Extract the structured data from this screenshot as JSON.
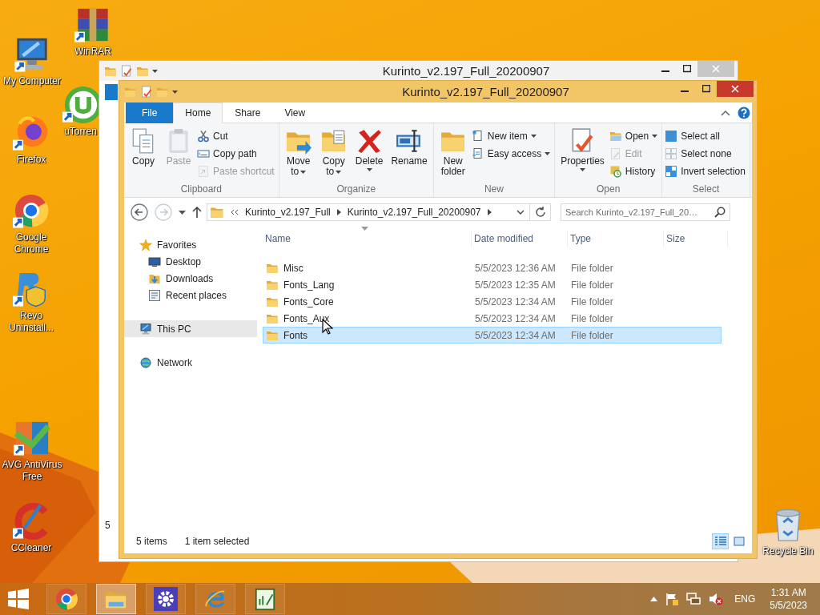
{
  "desktop_icons": [
    {
      "label": "My Computer"
    },
    {
      "label": "WinRAR"
    },
    {
      "label": "uTorren"
    },
    {
      "label": "Firefox"
    },
    {
      "label": "Google Chrome"
    },
    {
      "label": "Revo Uninstall..."
    },
    {
      "label": "AVG AntiVirus Free"
    },
    {
      "label": "CCleaner"
    },
    {
      "label": "Recycle Bin"
    }
  ],
  "back_window": {
    "title": "Kurinto_v2.197_Full_20200907",
    "status_text": "5"
  },
  "window": {
    "title": "Kurinto_v2.197_Full_20200907",
    "ribbon_tabs": [
      {
        "label": "File",
        "kind": "file",
        "selected": false
      },
      {
        "label": "Home",
        "kind": "tab",
        "selected": true
      },
      {
        "label": "Share",
        "kind": "tab",
        "selected": false
      },
      {
        "label": "View",
        "kind": "tab",
        "selected": false
      }
    ],
    "ribbon_groups": [
      {
        "label": "Clipboard",
        "items": [
          {
            "label": "Copy",
            "kind": "large",
            "disabled": false,
            "dropdown": false
          },
          {
            "label": "Paste",
            "kind": "large",
            "disabled": true,
            "dropdown": false
          },
          {
            "label": "Cut",
            "kind": "small",
            "disabled": false,
            "dropdown": false
          },
          {
            "label": "Copy path",
            "kind": "small",
            "disabled": false,
            "dropdown": false
          },
          {
            "label": "Paste shortcut",
            "kind": "small",
            "disabled": true,
            "dropdown": false
          }
        ]
      },
      {
        "label": "Organize",
        "items": [
          {
            "label": "Move to",
            "kind": "large",
            "disabled": false,
            "dropdown": true
          },
          {
            "label": "Copy to",
            "kind": "large",
            "disabled": false,
            "dropdown": true
          },
          {
            "label": "Delete",
            "kind": "large",
            "disabled": false,
            "dropdown": true
          },
          {
            "label": "Rename",
            "kind": "large",
            "disabled": false,
            "dropdown": false
          }
        ]
      },
      {
        "label": "New",
        "items": [
          {
            "label": "New folder",
            "kind": "large",
            "disabled": false,
            "dropdown": false
          },
          {
            "label": "New item",
            "kind": "small",
            "disabled": false,
            "dropdown": true
          },
          {
            "label": "Easy access",
            "kind": "small",
            "disabled": false,
            "dropdown": true
          }
        ]
      },
      {
        "label": "Open",
        "items": [
          {
            "label": "Properties",
            "kind": "large",
            "disabled": false,
            "dropdown": true
          },
          {
            "label": "Open",
            "kind": "small",
            "disabled": false,
            "dropdown": true
          },
          {
            "label": "Edit",
            "kind": "small",
            "disabled": true,
            "dropdown": false
          },
          {
            "label": "History",
            "kind": "small",
            "disabled": false,
            "dropdown": false
          }
        ]
      },
      {
        "label": "Select",
        "items": [
          {
            "label": "Select all",
            "kind": "small",
            "disabled": false,
            "dropdown": false
          },
          {
            "label": "Select none",
            "kind": "small",
            "disabled": false,
            "dropdown": false
          },
          {
            "label": "Invert selection",
            "kind": "small",
            "disabled": false,
            "dropdown": false
          }
        ]
      }
    ],
    "address": {
      "path": [
        "Kurinto_v2.197_Full",
        "Kurinto_v2.197_Full_20200907"
      ],
      "search": {
        "placeholder": "Search Kurinto_v2.197_Full_20…"
      }
    },
    "nav_pane": [
      {
        "label": "Favorites",
        "selected": false,
        "children": [
          {
            "label": "Desktop",
            "selected": false
          },
          {
            "label": "Downloads",
            "selected": false
          },
          {
            "label": "Recent places",
            "selected": false
          }
        ]
      },
      {
        "label": "This PC",
        "selected": true
      },
      {
        "label": "Network",
        "selected": false
      }
    ],
    "columns": [
      "Name",
      "Date modified",
      "Type",
      "Size"
    ],
    "rows": [
      {
        "name": "Misc",
        "date": "5/5/2023 12:36 AM",
        "type": "File folder",
        "selected": false
      },
      {
        "name": "Fonts_Lang",
        "date": "5/5/2023 12:35 AM",
        "type": "File folder",
        "selected": false
      },
      {
        "name": "Fonts_Core",
        "date": "5/5/2023 12:34 AM",
        "type": "File folder",
        "selected": false
      },
      {
        "name": "Fonts_Aux",
        "date": "5/5/2023 12:34 AM",
        "type": "File folder",
        "selected": false
      },
      {
        "name": "Fonts",
        "date": "5/5/2023 12:34 AM",
        "type": "File folder",
        "selected": true
      }
    ],
    "status_bar": {
      "count": "5 items",
      "selection": "1 item selected"
    },
    "view_buttons": [
      {
        "selected": true
      },
      {
        "selected": false
      }
    ]
  },
  "taskbar": {
    "apps": [
      {
        "selected": false
      },
      {
        "selected": true
      },
      {
        "selected": false
      },
      {
        "selected": false
      },
      {
        "selected": false
      }
    ],
    "language": "ENG",
    "time": "1:31 AM",
    "date": "5/5/2023"
  }
}
